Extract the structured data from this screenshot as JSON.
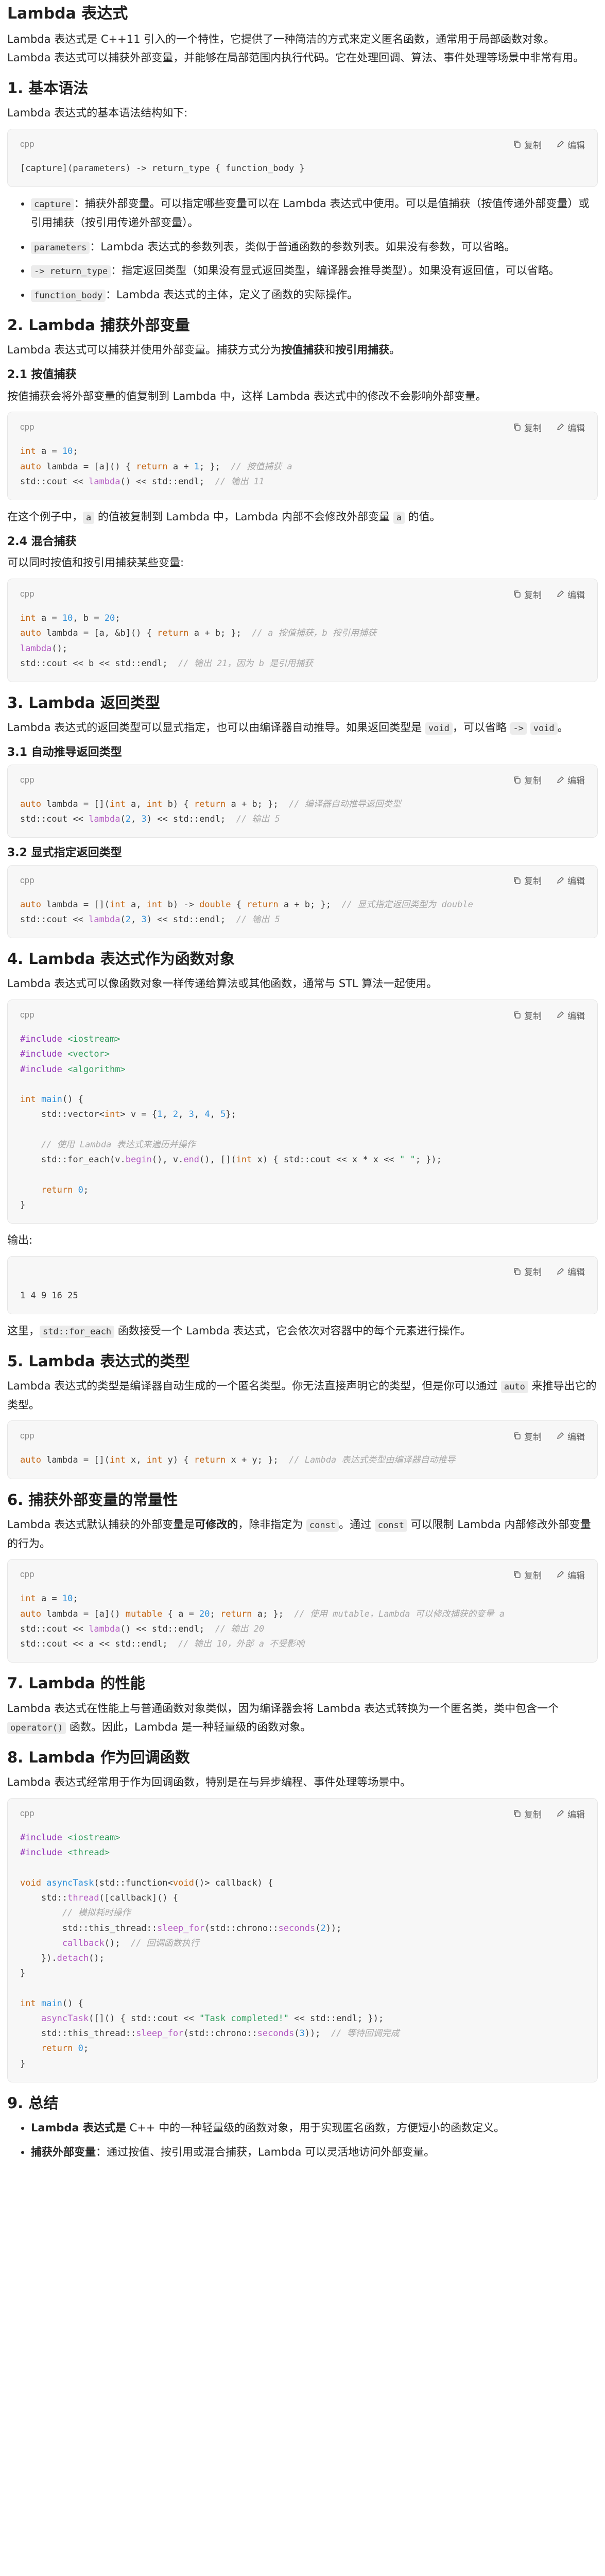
{
  "title": "Lambda 表达式",
  "intro": "Lambda 表达式是 C++11 引入的一个特性，它提供了一种简洁的方式来定义匿名函数，通常用于局部函数对象。Lambda 表达式可以捕获外部变量，并能够在局部范围内执行代码。它在处理回调、算法、事件处理等场景中非常有用。",
  "code_lang": "cpp",
  "copy_label": "复制",
  "edit_label": "编辑",
  "s1": {
    "heading": "1. 基本语法",
    "desc": "Lambda 表达式的基本语法结构如下:",
    "code": "[capture](parameters) -> return_type { function_body }",
    "items": [
      {
        "code": "capture",
        "text": "：捕获外部变量。可以指定哪些变量可以在 Lambda 表达式中使用。可以是值捕获（按值传递外部变量）或引用捕获（按引用传递外部变量）。"
      },
      {
        "code": "parameters",
        "text": "：Lambda 表达式的参数列表，类似于普通函数的参数列表。如果没有参数，可以省略。"
      },
      {
        "code": "-> return_type",
        "text": "：指定返回类型（如果没有显式返回类型，编译器会推导类型）。如果没有返回值，可以省略。"
      },
      {
        "code": "function_body",
        "text": "：Lambda 表达式的主体，定义了函数的实际操作。"
      }
    ]
  },
  "s2": {
    "heading": "2. Lambda 捕获外部变量",
    "desc_a": "Lambda 表达式可以捕获并使用外部变量。捕获方式分为",
    "desc_b": "按值捕获",
    "desc_c": "和",
    "desc_d": "按引用捕获",
    "desc_e": "。",
    "sub1": "2.1 按值捕获",
    "sub1_desc": "按值捕获会将外部变量的值复制到 Lambda 中，这样 Lambda 表达式中的修改不会影响外部变量。",
    "after_a": "在这个例子中，",
    "after_code1": "a",
    "after_b": " 的值被复制到 Lambda 中，Lambda 内部不会修改外部变量 ",
    "after_code2": "a",
    "after_c": " 的值。",
    "sub2": "2.4 混合捕获",
    "sub2_desc": "可以同时按值和按引用捕获某些变量:"
  },
  "s3": {
    "heading": "3. Lambda 返回类型",
    "desc_a": "Lambda 表达式的返回类型可以显式指定，也可以由编译器自动推导。如果返回类型是 ",
    "desc_code1": "void",
    "desc_b": "，可以省略 ",
    "desc_code2": "->",
    "desc_code3": "void",
    "desc_c": "。",
    "sub1": "3.1 自动推导返回类型",
    "sub2": "3.2 显式指定返回类型"
  },
  "s4": {
    "heading": "4. Lambda 表达式作为函数对象",
    "desc": "Lambda 表达式可以像函数对象一样传递给算法或其他函数，通常与 STL 算法一起使用。",
    "output_label": "输出:",
    "output": "1 4 9 16 25",
    "after_a": "这里，",
    "after_code": "std::for_each",
    "after_b": " 函数接受一个 Lambda 表达式，它会依次对容器中的每个元素进行操作。"
  },
  "s5": {
    "heading": "5. Lambda 表达式的类型",
    "desc_a": "Lambda 表达式的类型是编译器自动生成的一个匿名类型。你无法直接声明它的类型，但是你可以通过 ",
    "desc_code": "auto",
    "desc_b": " 来推导出它的类型。"
  },
  "s6": {
    "heading": "6. 捕获外部变量的常量性",
    "desc_a": "Lambda 表达式默认捕获的外部变量是",
    "desc_bold": "可修改的",
    "desc_b": "，除非指定为 ",
    "desc_code1": "const",
    "desc_c": "。通过 ",
    "desc_code2": "const",
    "desc_d": " 可以限制 Lambda 内部修改外部变量的行为。"
  },
  "s7": {
    "heading": "7. Lambda 的性能",
    "desc_a": "Lambda 表达式在性能上与普通函数对象类似，因为编译器会将 Lambda 表达式转换为一个匿名类，类中包含一个 ",
    "desc_code": "operator()",
    "desc_b": " 函数。因此，Lambda 是一种轻量级的函数对象。"
  },
  "s8": {
    "heading": "8. Lambda 作为回调函数",
    "desc": "Lambda 表达式经常用于作为回调函数，特别是在与异步编程、事件处理等场景中。"
  },
  "s9": {
    "heading": "9. 总结",
    "items": [
      {
        "bold": "Lambda 表达式是",
        "text": " C++ 中的一种轻量级的函数对象，用于实现匿名函数，方便短小的函数定义。"
      },
      {
        "bold": "捕获外部变量",
        "text": "：通过按值、按引用或混合捕获，Lambda 可以灵活地访问外部变量。"
      }
    ]
  }
}
